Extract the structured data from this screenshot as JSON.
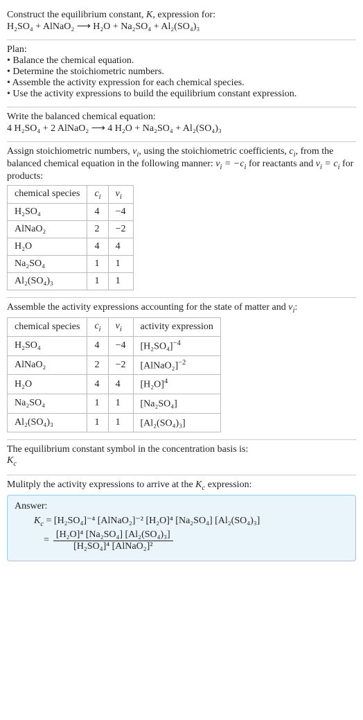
{
  "header": {
    "line1_a": "Construct the equilibrium constant, ",
    "line1_b": ", expression for:",
    "eq_unbalanced": "H₂SO₄ + AlNaO₂  ⟶  H₂O + Na₂SO₄ + Al₂(SO₄)₃"
  },
  "plan": {
    "title": "Plan:",
    "b1": "• Balance the chemical equation.",
    "b2": "• Determine the stoichiometric numbers.",
    "b3": "• Assemble the activity expression for each chemical species.",
    "b4": "• Use the activity expressions to build the equilibrium constant expression."
  },
  "balanced": {
    "title": "Write the balanced chemical equation:",
    "eq": "4 H₂SO₄ + 2 AlNaO₂  ⟶  4 H₂O + Na₂SO₄ + Al₂(SO₄)₃"
  },
  "stoich": {
    "p1a": "Assign stoichiometric numbers, ",
    "p1b": ", using the stoichiometric coefficients, ",
    "p1c": ", from the balanced chemical equation in the following manner: ",
    "p1d": " for reactants and ",
    "p1e": " for products:",
    "h_species": "chemical species",
    "rows": [
      {
        "s": "H₂SO₄",
        "c": "4",
        "v": "−4"
      },
      {
        "s": "AlNaO₂",
        "c": "2",
        "v": "−2"
      },
      {
        "s": "H₂O",
        "c": "4",
        "v": "4"
      },
      {
        "s": "Na₂SO₄",
        "c": "1",
        "v": "1"
      },
      {
        "s": "Al₂(SO₄)₃",
        "c": "1",
        "v": "1"
      }
    ]
  },
  "activity": {
    "p1a": "Assemble the activity expressions accounting for the state of matter and ",
    "p1b": ":",
    "h_species": "chemical species",
    "h_act": "activity expression",
    "rows": [
      {
        "s": "H₂SO₄",
        "c": "4",
        "v": "−4",
        "a_base": "[H₂SO₄]",
        "a_exp": "−4"
      },
      {
        "s": "AlNaO₂",
        "c": "2",
        "v": "−2",
        "a_base": "[AlNaO₂]",
        "a_exp": "−2"
      },
      {
        "s": "H₂O",
        "c": "4",
        "v": "4",
        "a_base": "[H₂O]",
        "a_exp": "4"
      },
      {
        "s": "Na₂SO₄",
        "c": "1",
        "v": "1",
        "a_base": "[Na₂SO₄]",
        "a_exp": ""
      },
      {
        "s": "Al₂(SO₄)₃",
        "c": "1",
        "v": "1",
        "a_base": "[Al₂(SO₄)₃]",
        "a_exp": ""
      }
    ]
  },
  "kc_symbol": {
    "l1": "The equilibrium constant symbol in the concentration basis is:"
  },
  "final": {
    "l1a": "Mulitply the activity expressions to arrive at the ",
    "l1b": " expression:",
    "answer_label": "Answer:",
    "line1": "= [H₂SO₄]⁻⁴ [AlNaO₂]⁻² [H₂O]⁴ [Na₂SO₄] [Al₂(SO₄)₃]",
    "num": "[H₂O]⁴ [Na₂SO₄] [Al₂(SO₄)₃]",
    "den": "[H₂SO₄]⁴ [AlNaO₂]²"
  }
}
